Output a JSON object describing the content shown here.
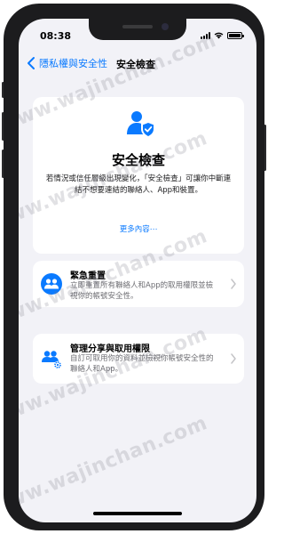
{
  "status_bar": {
    "time": "08:38"
  },
  "nav": {
    "back_label": "隱私權與安全性",
    "title": "安全檢查"
  },
  "safety_card": {
    "icon": "shield-user-icon",
    "title": "安全檢查",
    "description": "若情況或信任層級出現變化，「安全檢查」可讓你中斷連結不想要連結的聯絡人、App和裝置。",
    "more_link": "更多內容⋯"
  },
  "options": [
    {
      "icon": "people-reset-icon",
      "title": "緊急重置",
      "description": "立即重置所有聯絡人和App的取用權限並檢視你的帳號安全性。"
    },
    {
      "icon": "people-settings-icon",
      "title": "管理分享與取用權限",
      "description": "自訂可取用你的資料並檢視你帳號安全性的聯絡人和App。"
    }
  ],
  "watermark": "www.wajinchan.com",
  "colors": {
    "accent": "#0a7aff",
    "background": "#f2f2f7",
    "card": "#ffffff"
  }
}
